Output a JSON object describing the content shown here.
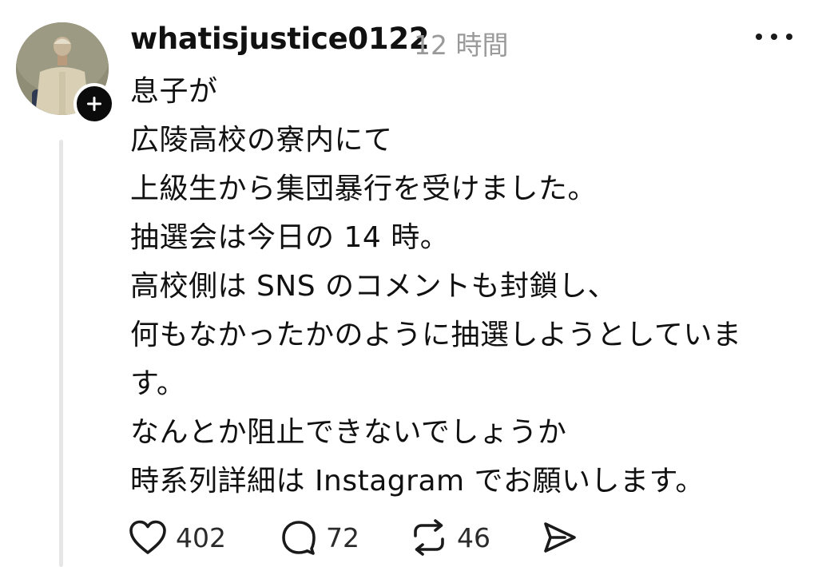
{
  "post": {
    "username": "whatisjustice0122",
    "timestamp": "12 時間",
    "body_lines": [
      "息子が",
      "広陵高校の寮内にて",
      "上級生から集団暴行を受けました。",
      "抽選会は今日の 14 時。",
      "高校側は SNS のコメントも封鎖し、",
      "何もなかったかのように抽選しようとしていま",
      "す。",
      "なんとか阻止できないでしょうか",
      "時系列詳細は Instagram でお願いします。"
    ],
    "actions": {
      "like_count": "402",
      "reply_count": "72",
      "repost_count": "46"
    }
  },
  "icons": {
    "more": "more-horizontal-icon",
    "follow": "plus-icon",
    "like": "heart-icon",
    "reply": "comment-bubble-icon",
    "repost": "repost-icon",
    "share": "send-icon"
  },
  "colors": {
    "text": "#111111",
    "muted": "#9a9a9a",
    "thread_line": "#e6e6e6",
    "badge": "#0b0b0b"
  }
}
